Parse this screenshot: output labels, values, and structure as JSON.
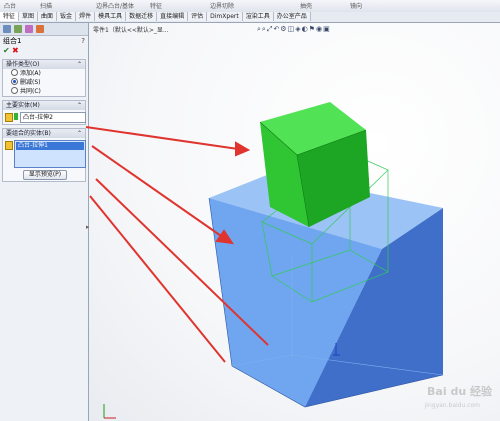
{
  "topbar": {
    "items": [
      "凸台",
      "扫描",
      "边界凸台/基体",
      "特征",
      "边界切除",
      "抽壳",
      "镜向"
    ]
  },
  "tabs": [
    "特征",
    "草图",
    "曲面",
    "钣金",
    "焊件",
    "模具工具",
    "数据迁移",
    "直接编辑",
    "评估",
    "DimXpert",
    "渲染工具",
    "办公室产品"
  ],
  "panel": {
    "title": "组合1",
    "help": "?",
    "ok": "✔",
    "cancel": "✖",
    "operation_group": {
      "title": "操作类型(O)",
      "options": [
        "添加(A)",
        "删减(S)",
        "共同(C)"
      ],
      "selected_index": 1
    },
    "main_body_group": {
      "title": "主要实体(M)",
      "value": "凸台-拉伸2"
    },
    "subtract_group": {
      "title": "要组合的实体(B)",
      "value": "凸台-拉伸1",
      "button": "显示预览(P)"
    }
  },
  "viewport": {
    "doc_path": "零件1（默认<<默认>_显...",
    "toolbar_glyphs": "⌕⌕⤢↶⚙◫◈◐⚑◉▣",
    "watermark": "Bai du 经验",
    "watermark_sub": "jingyan.baidu.com"
  },
  "colors": {
    "green_cube": "#22c42a",
    "blue_cube": "#4a86e8",
    "arrow": "#e0342f"
  }
}
